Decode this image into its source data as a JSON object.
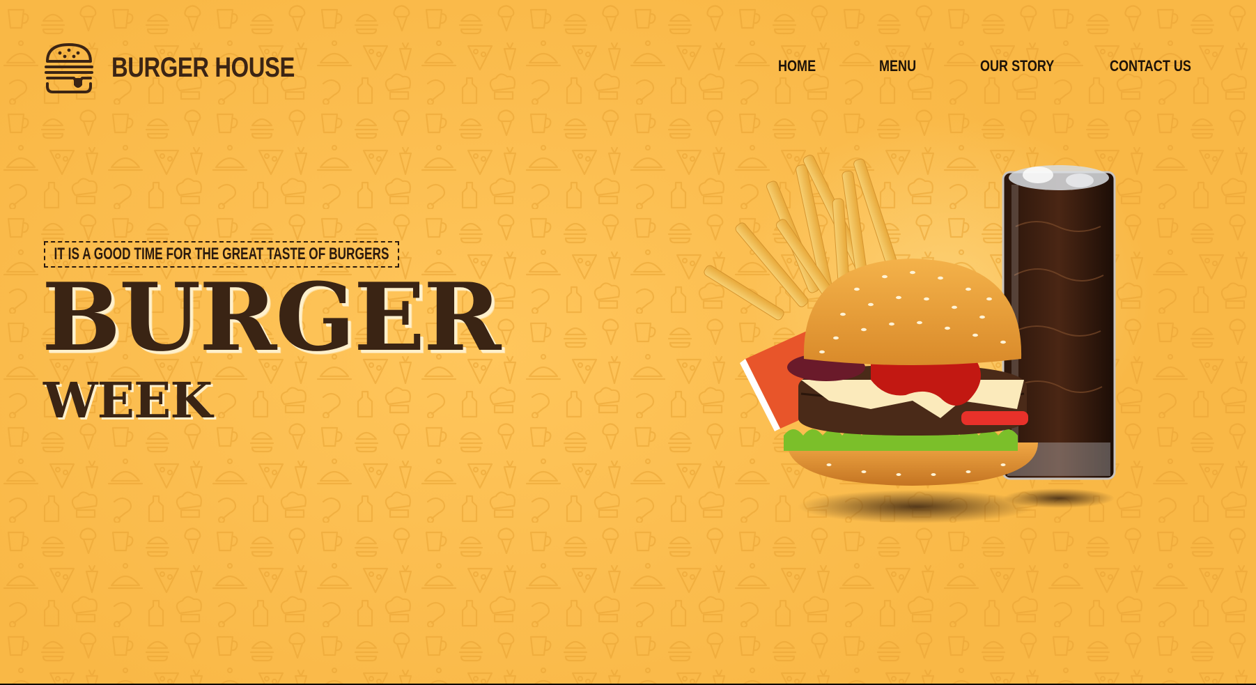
{
  "header": {
    "brand": "BURGER HOUSE",
    "logo_icon": "burger-icon"
  },
  "nav": {
    "items": [
      {
        "label": "HOME"
      },
      {
        "label": "MENU"
      },
      {
        "label": "OUR STORY"
      },
      {
        "label": "CONTACT US"
      }
    ]
  },
  "hero": {
    "tagline": "IT IS A GOOD TIME FOR THE GREAT TASTE OF BURGERS",
    "title_line1": "BURGER",
    "title_line2": "WEEK",
    "image": "burger-fries-cola-image"
  },
  "colors": {
    "background": "#fbbd4f",
    "text_dark": "#3a2414",
    "nav_text": "#1d1208"
  }
}
